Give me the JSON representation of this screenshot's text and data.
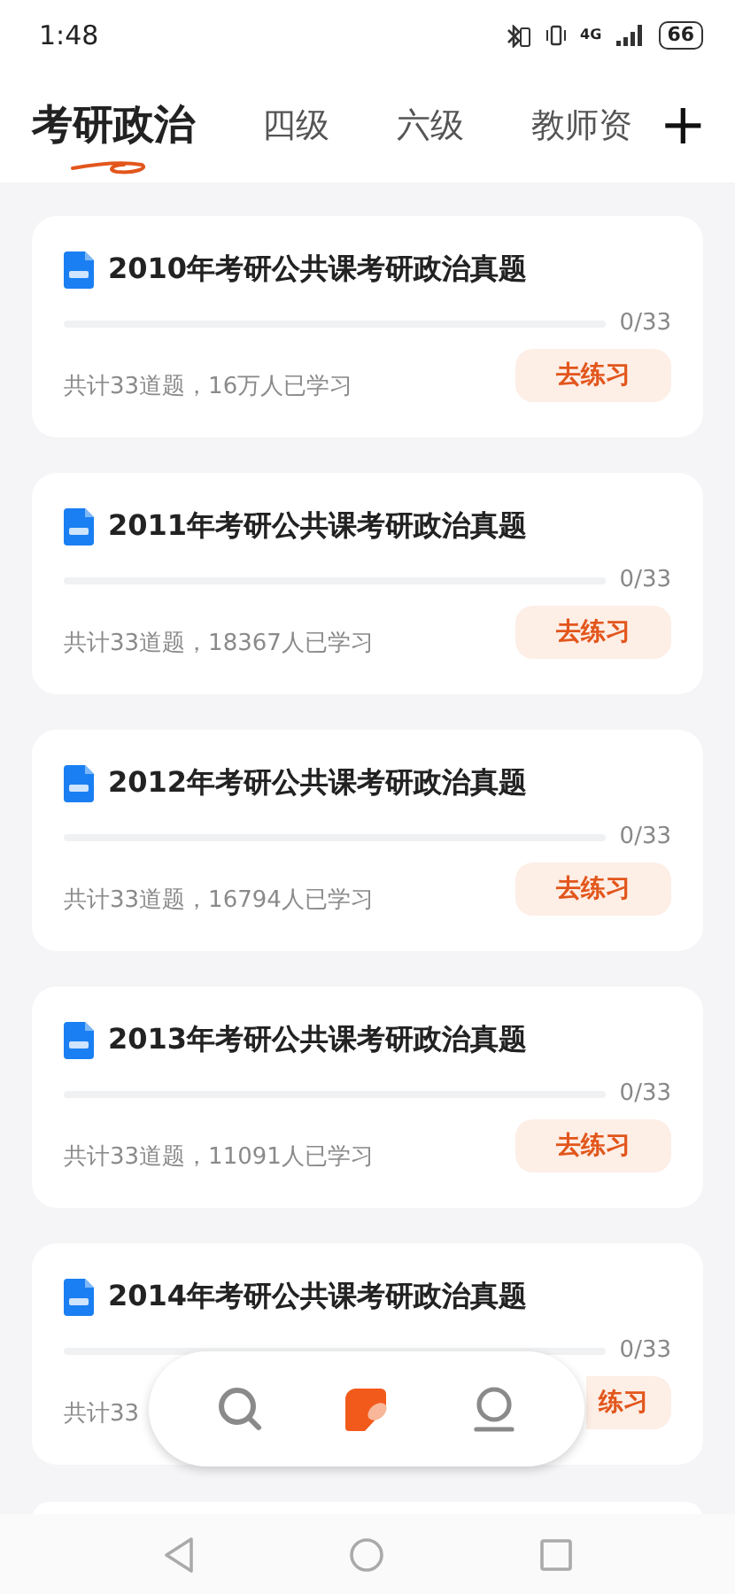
{
  "status_bar": {
    "time": "1:48",
    "battery": "66",
    "network": "4G"
  },
  "tabs": [
    {
      "label": "考研政治",
      "selected": true
    },
    {
      "label": "四级",
      "selected": false
    },
    {
      "label": "六级",
      "selected": false
    },
    {
      "label": "教师资",
      "selected": false
    }
  ],
  "add_button": "+",
  "cards": [
    {
      "title": "2010年考研公共课考研政治真题",
      "level": 0,
      "progress": "0/33",
      "stats": "共计33道题，16万人已学习",
      "button": "去练习"
    },
    {
      "title": "2011年考研公共课考研政治真题",
      "level": 0,
      "progress": "0/33",
      "stats": "共计33道题，18367人已学习",
      "button": "去练习"
    },
    {
      "title": "2012年考研公共课考研政治真题",
      "level": 0,
      "progress": "0/33",
      "stats": "共计33道题，16794人已学习",
      "button": "去练习"
    },
    {
      "title": "2013年考研公共课考研政治真题",
      "level": 0,
      "progress": "0/33",
      "stats": "共计33道题，11091人已学习",
      "button": "去练习"
    },
    {
      "title": "2014年考研公共课考研政治真题",
      "level": 0,
      "progress": "0/33",
      "stats": "共计33",
      "button": "练习"
    }
  ],
  "bottom_nav": [
    {
      "kind": "search",
      "selected": false
    },
    {
      "kind": "practice",
      "selected": true
    },
    {
      "kind": "profile",
      "selected": false
    }
  ]
}
